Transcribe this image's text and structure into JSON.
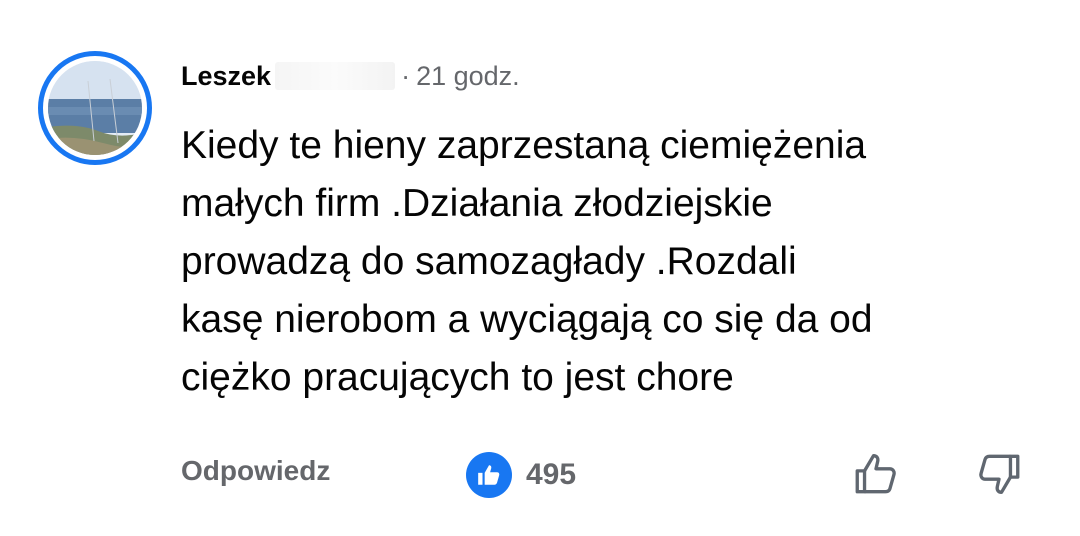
{
  "comment": {
    "author": "Leszek",
    "time": "21 godz.",
    "separator": "·",
    "lines": [
      "Kiedy te hieny zaprzestaną ciemiężenia",
      "małych firm .Działania złodziejskie",
      "prowadzą do samozagłady .Rozdali",
      "kasę nierobom a wyciągają co się da od",
      "ciężko pracujących to jest chore"
    ]
  },
  "actions": {
    "reply_label": "Odpowiedz",
    "reaction_type": "like",
    "reaction_count": "495",
    "upvote_icon": "thumb-up-outline-icon",
    "downvote_icon": "thumb-down-outline-icon"
  },
  "colors": {
    "accent": "#1877f2",
    "text": "#050505",
    "secondary": "#65676b"
  }
}
